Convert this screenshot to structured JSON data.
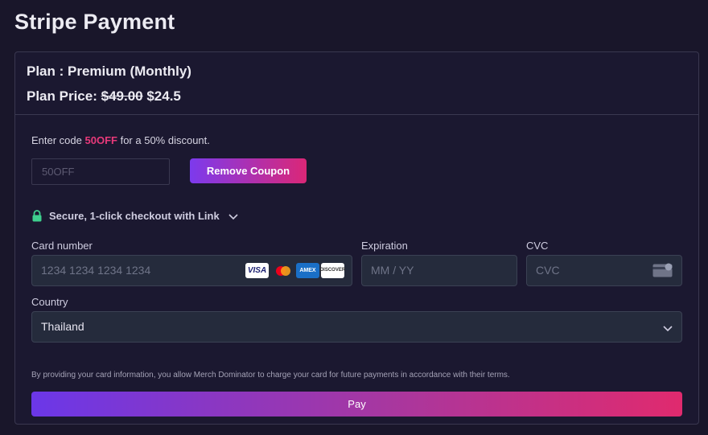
{
  "page": {
    "title": "Stripe Payment"
  },
  "plan": {
    "name": "Plan : Premium (Monthly)",
    "price_label": "Plan Price:",
    "old_price": "$49.00",
    "new_price": "$24.5"
  },
  "coupon": {
    "hint_prefix": "Enter code",
    "code": "50OFF",
    "hint_suffix": "for a 50% discount.",
    "input_value": "50OFF",
    "remove_label": "Remove Coupon"
  },
  "link": {
    "text": "Secure, 1-click checkout with Link"
  },
  "card": {
    "number_label": "Card number",
    "number_placeholder": "1234 1234 1234 1234",
    "brands": [
      "visa-icon",
      "mastercard-icon",
      "amex-icon",
      "discover-icon"
    ],
    "visa_text": "VISA",
    "amex_text": "AMEX",
    "discover_text": "DISCOVER",
    "expiration_label": "Expiration",
    "expiration_placeholder": "MM / YY",
    "cvc_label": "CVC",
    "cvc_placeholder": "CVC"
  },
  "country": {
    "label": "Country",
    "value": "Thailand"
  },
  "terms": "By providing your card information, you allow Merch Dominator to charge your card for future payments in accordance with their terms.",
  "pay": {
    "label": "Pay"
  },
  "colors": {
    "background": "#19162a",
    "accent_pink": "#e8397a",
    "gradient_start": "#7c3aed",
    "gradient_end": "#db2777",
    "lock_green": "#3ecf8e"
  }
}
